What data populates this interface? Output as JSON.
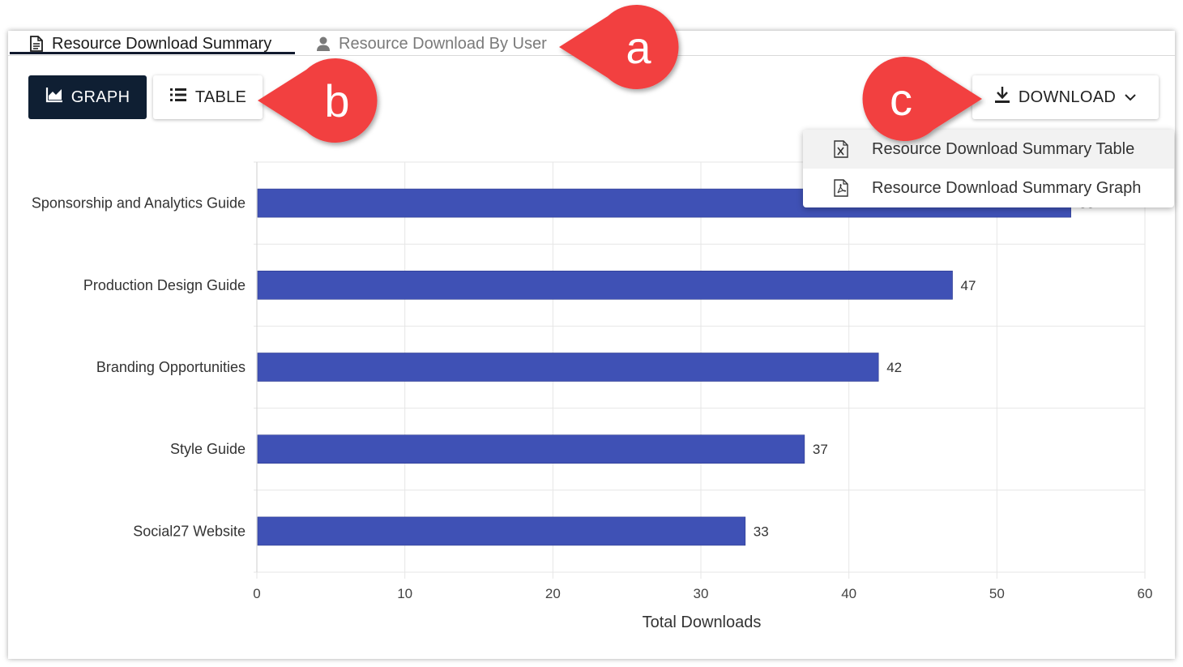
{
  "tabs": {
    "active_label": "Resource Download Summary",
    "inactive_label": "Resource Download By User"
  },
  "view_toggle": {
    "graph_label": "GRAPH",
    "table_label": "TABLE"
  },
  "download": {
    "button_label": "DOWNLOAD",
    "menu_items": [
      {
        "label": "Resource Download Summary Table",
        "icon": "excel-file-icon"
      },
      {
        "label": "Resource Download Summary Graph",
        "icon": "pdf-file-icon"
      }
    ]
  },
  "callouts": [
    "a",
    "b",
    "c"
  ],
  "colors": {
    "bar": "#3f51b5",
    "primary_button": "#0f1f33",
    "callout": "#f24141"
  },
  "chart_data": {
    "type": "bar",
    "orientation": "horizontal",
    "categories": [
      "Sponsorship and Analytics Guide",
      "Production Design Guide",
      "Branding Opportunities",
      "Style Guide",
      "Social27 Website"
    ],
    "values": [
      55,
      47,
      42,
      37,
      33
    ],
    "xlabel": "Total Downloads",
    "xlim": [
      0,
      60
    ],
    "xticks": [
      0,
      10,
      20,
      30,
      40,
      50,
      60
    ],
    "grid": true
  }
}
